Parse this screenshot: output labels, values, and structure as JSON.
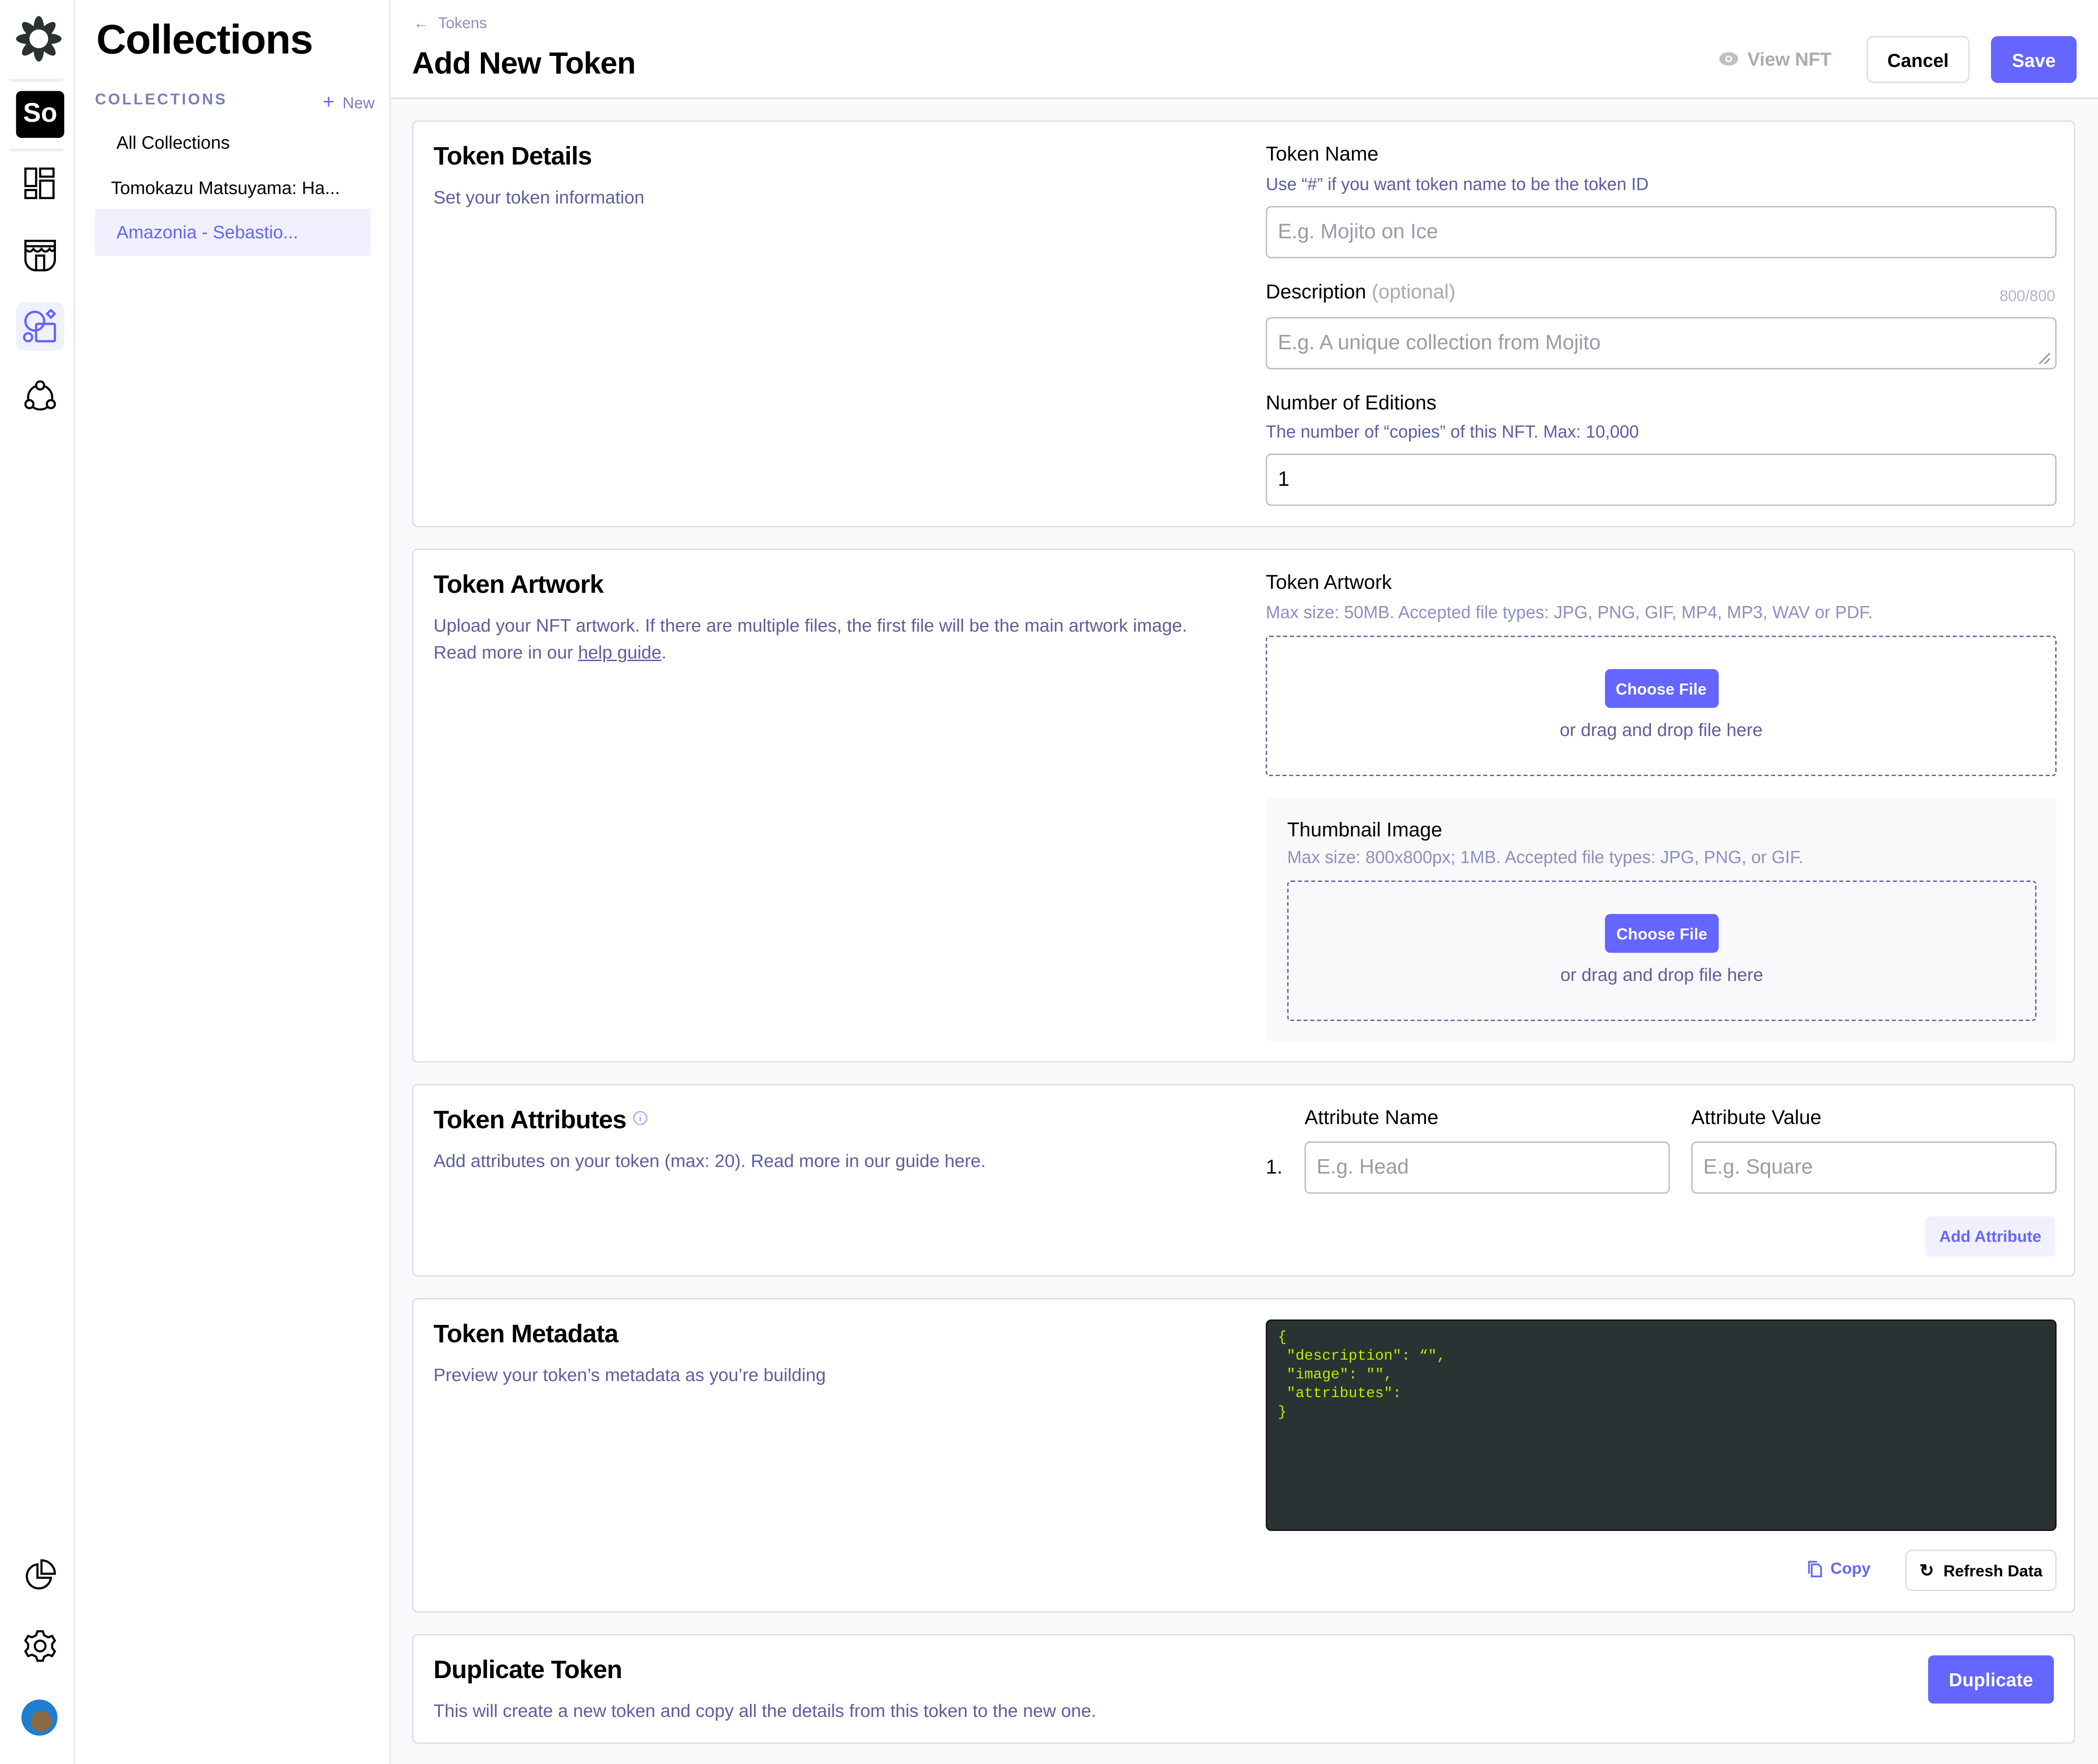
{
  "rail": {
    "icons": [
      "flower-logo-icon",
      "workspace-avatar",
      "dashboard-icon",
      "storefront-icon",
      "shapes-icon",
      "network-icon",
      "pie-chart-icon",
      "gear-icon",
      "user-avatar"
    ],
    "workspace_initials": "So",
    "active": "shapes-icon"
  },
  "collections_panel": {
    "title": "Collections",
    "section_label": "COLLECTIONS",
    "new_label": "New",
    "items": [
      {
        "label": "All Collections",
        "active": false
      },
      {
        "label": "Tomokazu Matsuyama: Ha...",
        "active": false
      },
      {
        "label": "Amazonia - Sebastio...",
        "active": true
      }
    ]
  },
  "header": {
    "breadcrumb": "Tokens",
    "title": "Add New Token",
    "view_nft_label": "View NFT",
    "cancel_label": "Cancel",
    "save_label": "Save"
  },
  "token_details": {
    "title": "Token Details",
    "description": "Set your token information",
    "token_name": {
      "label": "Token Name",
      "help": "Use “#” if you want token name to be the token ID",
      "placeholder": "E.g. Mojito on Ice",
      "value": ""
    },
    "description_field": {
      "label": "Description",
      "optional": "(optional)",
      "counter": "800/800",
      "placeholder": "E.g. A unique collection from Mojito",
      "value": ""
    },
    "editions": {
      "label": "Number of Editions",
      "help": "The number of “copies” of this NFT. Max: 10,000",
      "value": "1"
    }
  },
  "token_artwork": {
    "title": "Token Artwork",
    "description": "Upload your NFT artwork. If there are multiple files, the first file will be the main artwork image. Read more in our ",
    "help_link": "help guide",
    "description_end": ".",
    "artwork": {
      "label": "Token Artwork",
      "help": "Max size: 50MB. Accepted file types: JPG, PNG, GIF, MP4, MP3, WAV or PDF.",
      "choose_label": "Choose File",
      "drop_label": "or drag and drop file here"
    },
    "thumbnail": {
      "label": "Thumbnail Image",
      "help": "Max size: 800x800px; 1MB. Accepted file types: JPG, PNG, or GIF.",
      "choose_label": "Choose File",
      "drop_label": "or drag and drop file here"
    }
  },
  "token_attributes": {
    "title": "Token Attributes",
    "description": "Add attributes on your token (max: 20). Read more in our guide here.",
    "name_header": "Attribute Name",
    "value_header": "Attribute Value",
    "rows": [
      {
        "index": "1.",
        "name_placeholder": "E.g. Head",
        "value_placeholder": "E.g. Square",
        "name": "",
        "value": ""
      }
    ],
    "add_label": "Add Attribute"
  },
  "token_metadata": {
    "title": "Token Metadata",
    "description": "Preview your token’s metadata as you’re building",
    "code": "{\n \"description\": “\",\n \"image\": \"\",\n \"attributes\":\n}",
    "copy_label": "Copy",
    "refresh_label": "Refresh Data"
  },
  "duplicate": {
    "title": "Duplicate Token",
    "description": "This will create a new token and copy all the details from this token to the new one.",
    "button_label": "Duplicate"
  },
  "colors": {
    "accent": "#6565ff",
    "accent_light": "#f0f0ff",
    "muted_text": "#5c5e9e",
    "code_bg": "#2b3234",
    "code_text": "#b3f000"
  }
}
